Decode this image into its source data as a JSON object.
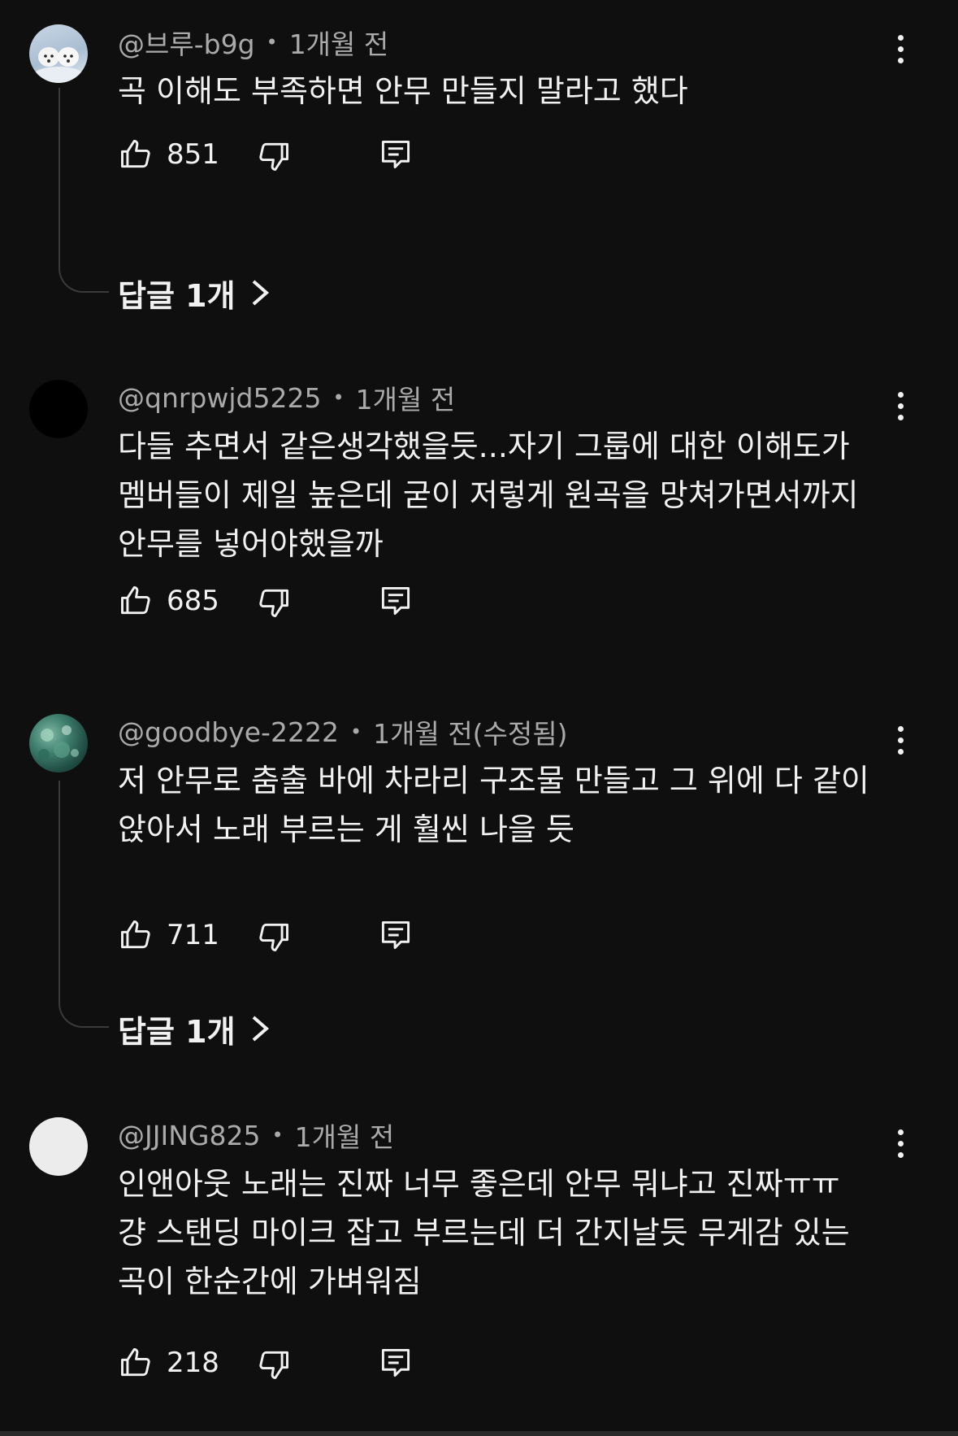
{
  "comments": [
    {
      "author": "@브루-b9g",
      "time": "1개월 전",
      "lines": [
        "곡 이해도 부족하면 안무 만들지 말라고 했다"
      ],
      "likes": "851",
      "replies_label": "답글 1개",
      "avatar_icon": "puppies-avatar"
    },
    {
      "author": "@qnrpwjd5225",
      "time": "1개월 전",
      "lines": [
        "다들 추면서 같은생각했을듯...자기 그룹에 대한 이해도가",
        "멤버들이 제일 높은데 굳이 저렇게 원곡을 망쳐가면서까지",
        "안무를 넣어야했을까"
      ],
      "likes": "685",
      "avatar_icon": "black-avatar"
    },
    {
      "author": "@goodbye-2222",
      "time": "1개월 전(수정됨)",
      "lines": [
        "저 안무로 춤출 바에 차라리 구조물 만들고 그 위에 다 같이",
        "앉아서 노래 부르는 게 훨씬 나을 듯"
      ],
      "likes": "711",
      "replies_label": "답글 1개",
      "avatar_icon": "green-avatar"
    },
    {
      "author": "@JJING825",
      "time": "1개월 전",
      "lines": [
        "인앤아웃 노래는 진짜 너무 좋은데 안무 뭐냐고 진짜ㅠㅠ",
        "걍 스탠딩 마이크 잡고 부르는데 더 간지날듯 무게감 있는",
        "곡이 한순간에 가벼워짐"
      ],
      "likes": "218",
      "avatar_icon": "white-avatar"
    }
  ],
  "icons": {
    "like": "thumbs-up-icon",
    "dislike": "thumbs-down-icon",
    "reply": "reply-comment-icon",
    "more": "more-vert-icon",
    "chevron": "chevron-right-icon"
  },
  "colors": {
    "background": "#0f0f0f",
    "text": "#f1f1f1",
    "meta": "#aaaaaa"
  }
}
